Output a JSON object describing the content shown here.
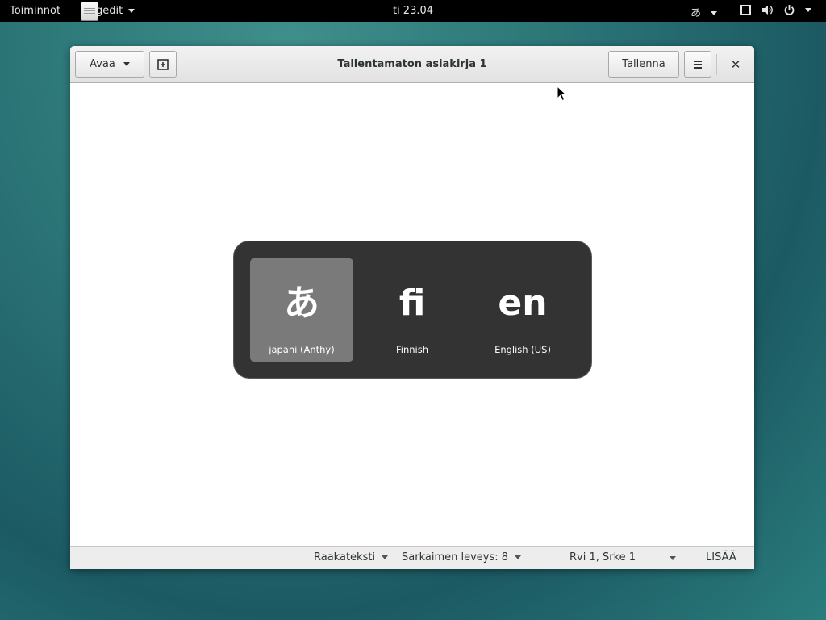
{
  "topbar": {
    "activities": "Toiminnot",
    "app_name": "gedit",
    "clock": "ti 23.04",
    "input_indicator": "あ"
  },
  "window": {
    "title": "Tallentamaton asiakirja 1",
    "open_label": "Avaa",
    "save_label": "Tallenna",
    "close_glyph": "✕",
    "menu_glyph": "☰"
  },
  "statusbar": {
    "language": "Raakateksti",
    "tab_width": "Sarkaimen leveys: 8",
    "position": "Rvi 1, Srke 1",
    "mode": "LISÄÄ"
  },
  "switcher": {
    "sources": [
      {
        "glyph": "あ",
        "label": "japani (Anthy)",
        "selected": true
      },
      {
        "glyph": "fi",
        "label": "Finnish",
        "selected": false
      },
      {
        "glyph": "en",
        "label": "English (US)",
        "selected": false
      }
    ]
  }
}
